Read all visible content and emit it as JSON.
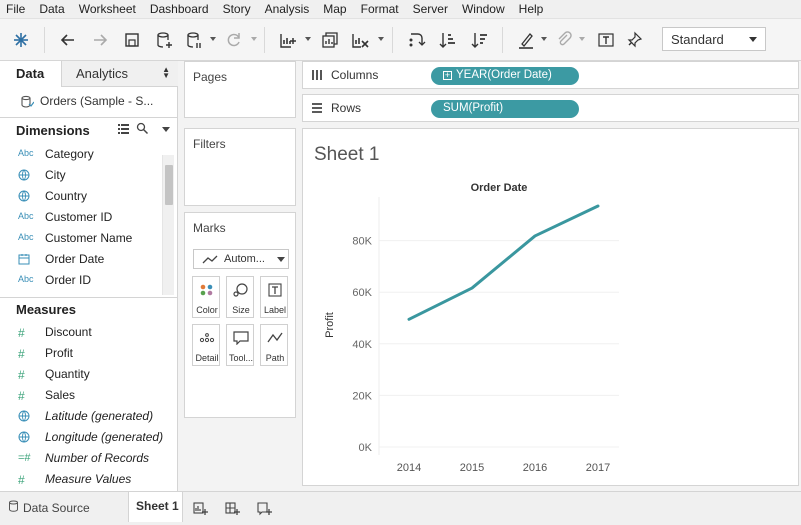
{
  "menu": [
    "File",
    "Data",
    "Worksheet",
    "Dashboard",
    "Story",
    "Analysis",
    "Map",
    "Format",
    "Server",
    "Window",
    "Help"
  ],
  "toolbar": {
    "fit_select": "Standard"
  },
  "left_pane": {
    "tab_data": "Data",
    "tab_analytics": "Analytics",
    "datasource": "Orders (Sample - S...",
    "dimensions_header": "Dimensions",
    "dimensions": [
      {
        "type": "Abc",
        "label": "Category"
      },
      {
        "type": "geo",
        "label": "City"
      },
      {
        "type": "geo",
        "label": "Country"
      },
      {
        "type": "Abc",
        "label": "Customer ID"
      },
      {
        "type": "Abc",
        "label": "Customer Name"
      },
      {
        "type": "date",
        "label": "Order Date"
      },
      {
        "type": "Abc",
        "label": "Order ID"
      }
    ],
    "measures_header": "Measures",
    "measures": [
      {
        "type": "#",
        "label": "Discount"
      },
      {
        "type": "#",
        "label": "Profit"
      },
      {
        "type": "#",
        "label": "Quantity"
      },
      {
        "type": "#",
        "label": "Sales"
      },
      {
        "type": "geo",
        "label": "Latitude (generated)"
      },
      {
        "type": "geo",
        "label": "Longitude (generated)"
      },
      {
        "type": "=#",
        "label": "Number of Records"
      },
      {
        "type": "#",
        "label": "Measure Values"
      }
    ]
  },
  "cards": {
    "pages": "Pages",
    "filters": "Filters",
    "marks": "Marks",
    "marks_type": "Autom...",
    "mark_buttons": [
      "Color",
      "Size",
      "Label",
      "Detail",
      "Tool...",
      "Path"
    ]
  },
  "shelves": {
    "columns_label": "Columns",
    "columns_pill": "YEAR(Order Date)",
    "rows_label": "Rows",
    "rows_pill": "SUM(Profit)"
  },
  "sheet_title": "Sheet 1",
  "chart_data": {
    "type": "line",
    "title": "Order Date",
    "xlabel": "",
    "ylabel": "Profit",
    "categories": [
      "2014",
      "2015",
      "2016",
      "2017"
    ],
    "values": [
      49500,
      61600,
      81800,
      93400
    ],
    "yticks": [
      "0K",
      "20K",
      "40K",
      "60K",
      "80K"
    ],
    "ylim": [
      0,
      100000
    ],
    "color": "#3a979f",
    "grid": true
  },
  "bottom": {
    "datasource_tab": "Data Source",
    "sheet_tab": "Sheet 1"
  }
}
